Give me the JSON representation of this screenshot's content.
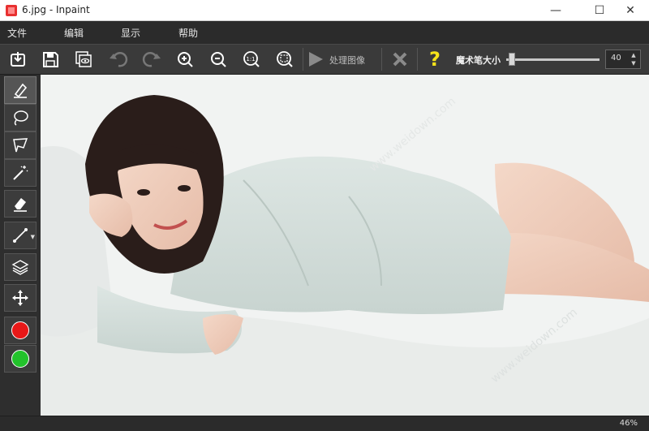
{
  "window": {
    "title": "6.jpg - Inpaint",
    "minimize": "—",
    "maximize": "☐",
    "close": "✕"
  },
  "menu": {
    "items": [
      "文件",
      "编辑",
      "显示",
      "帮助"
    ]
  },
  "toolbar": {
    "buttons": [
      "import-icon",
      "save-icon",
      "save-copy-icon",
      "undo-icon",
      "redo-icon",
      "zoom-in-icon",
      "zoom-out-icon",
      "zoom-actual-icon",
      "zoom-fit-icon"
    ],
    "zoom_actual_text": "1:1",
    "process_label": "处理图像",
    "help_label": "?",
    "brush_size_label": "魔术笔大小",
    "brush_size_value": "40",
    "brush_size_fraction": 0.06
  },
  "sidebar": {
    "tools": [
      "marker-icon",
      "lasso-icon",
      "polygon-lasso-icon",
      "magic-wand-icon",
      "eraser-icon",
      "line-icon",
      "layers-icon",
      "move-icon",
      "red-marker-icon",
      "green-marker-icon"
    ]
  },
  "status": {
    "zoom": "46%"
  },
  "colors": {
    "accent_red": "#e81818",
    "accent_green": "#22c22b",
    "help_yellow": "#f5e21a",
    "app_icon_red": "#e83030"
  },
  "watermark": "www.weidown.com"
}
